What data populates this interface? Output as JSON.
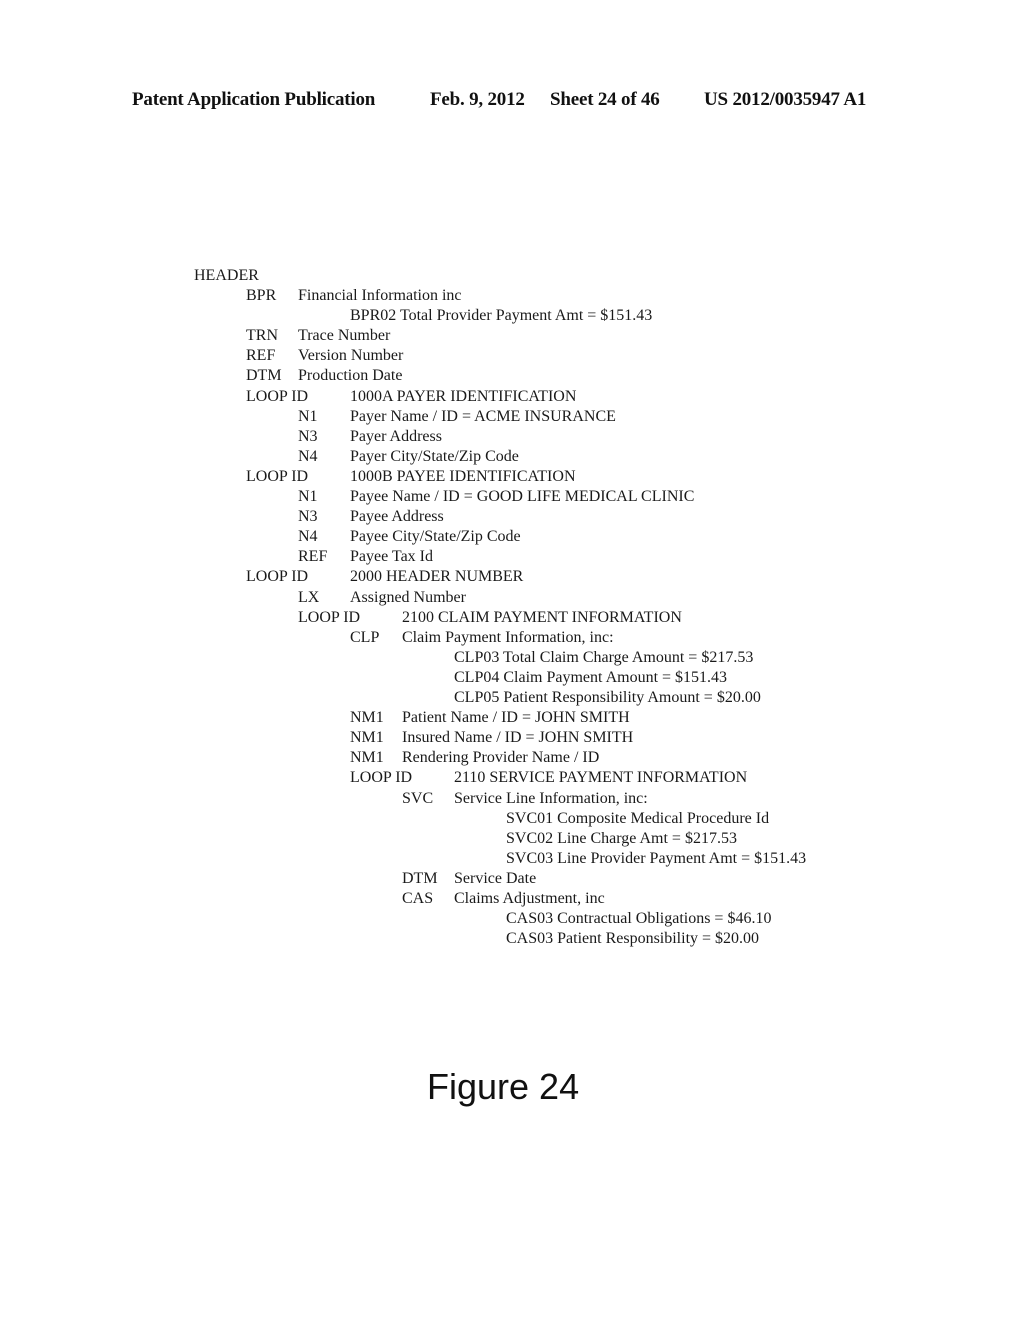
{
  "header": {
    "publication": "Patent Application Publication",
    "date": "Feb. 9, 2012",
    "sheet": "Sheet 24 of 46",
    "number": "US 2012/0035947 A1"
  },
  "figure_label": "Figure 24",
  "tree": {
    "root": "HEADER",
    "lines": [
      {
        "code": "BPR",
        "desc": "Financial Information inc"
      },
      {
        "code": "",
        "desc": "BPR02 Total Provider Payment Amt = $151.43"
      },
      {
        "code": "TRN",
        "desc": "Trace Number"
      },
      {
        "code": "REF",
        "desc": "Version Number"
      },
      {
        "code": "DTM",
        "desc": "Production Date"
      },
      {
        "code": "LOOP ID",
        "desc": "1000A PAYER IDENTIFICATION"
      },
      {
        "code": "N1",
        "desc": "Payer Name / ID = ACME INSURANCE"
      },
      {
        "code": "N3",
        "desc": "Payer Address"
      },
      {
        "code": "N4",
        "desc": "Payer City/State/Zip Code"
      },
      {
        "code": "LOOP ID",
        "desc": "1000B PAYEE IDENTIFICATION"
      },
      {
        "code": "N1",
        "desc": "Payee Name / ID = GOOD LIFE MEDICAL CLINIC"
      },
      {
        "code": "N3",
        "desc": "Payee Address"
      },
      {
        "code": "N4",
        "desc": "Payee City/State/Zip Code"
      },
      {
        "code": "REF",
        "desc": "Payee Tax Id"
      },
      {
        "code": "LOOP ID",
        "desc": "2000 HEADER NUMBER"
      },
      {
        "code": "LX",
        "desc": "Assigned Number"
      },
      {
        "code": "LOOP ID",
        "desc": "2100 CLAIM PAYMENT INFORMATION"
      },
      {
        "code": "CLP",
        "desc": "Claim Payment Information, inc:"
      },
      {
        "code": "",
        "desc": "CLP03 Total Claim Charge Amount = $217.53"
      },
      {
        "code": "",
        "desc": "CLP04 Claim Payment Amount = $151.43"
      },
      {
        "code": "",
        "desc": "CLP05 Patient Responsibility Amount = $20.00"
      },
      {
        "code": "NM1",
        "desc": "Patient Name / ID = JOHN SMITH"
      },
      {
        "code": "NM1",
        "desc": "Insured Name / ID = JOHN SMITH"
      },
      {
        "code": "NM1",
        "desc": "Rendering Provider Name / ID"
      },
      {
        "code": "LOOP ID",
        "desc": "2110 SERVICE PAYMENT INFORMATION"
      },
      {
        "code": "SVC",
        "desc": "Service Line Information, inc:"
      },
      {
        "code": "",
        "desc": "SVC01 Composite Medical Procedure Id"
      },
      {
        "code": "",
        "desc": "SVC02 Line Charge Amt = $217.53"
      },
      {
        "code": "",
        "desc": "SVC03 Line Provider Payment Amt = $151.43"
      },
      {
        "code": "DTM",
        "desc": "Service Date"
      },
      {
        "code": "CAS",
        "desc": "Claims Adjustment, inc"
      },
      {
        "code": "",
        "desc": "CAS03 Contractual Obligations = $46.10"
      },
      {
        "code": "",
        "desc": "CAS03 Patient Responsibility = $20.00"
      }
    ]
  }
}
